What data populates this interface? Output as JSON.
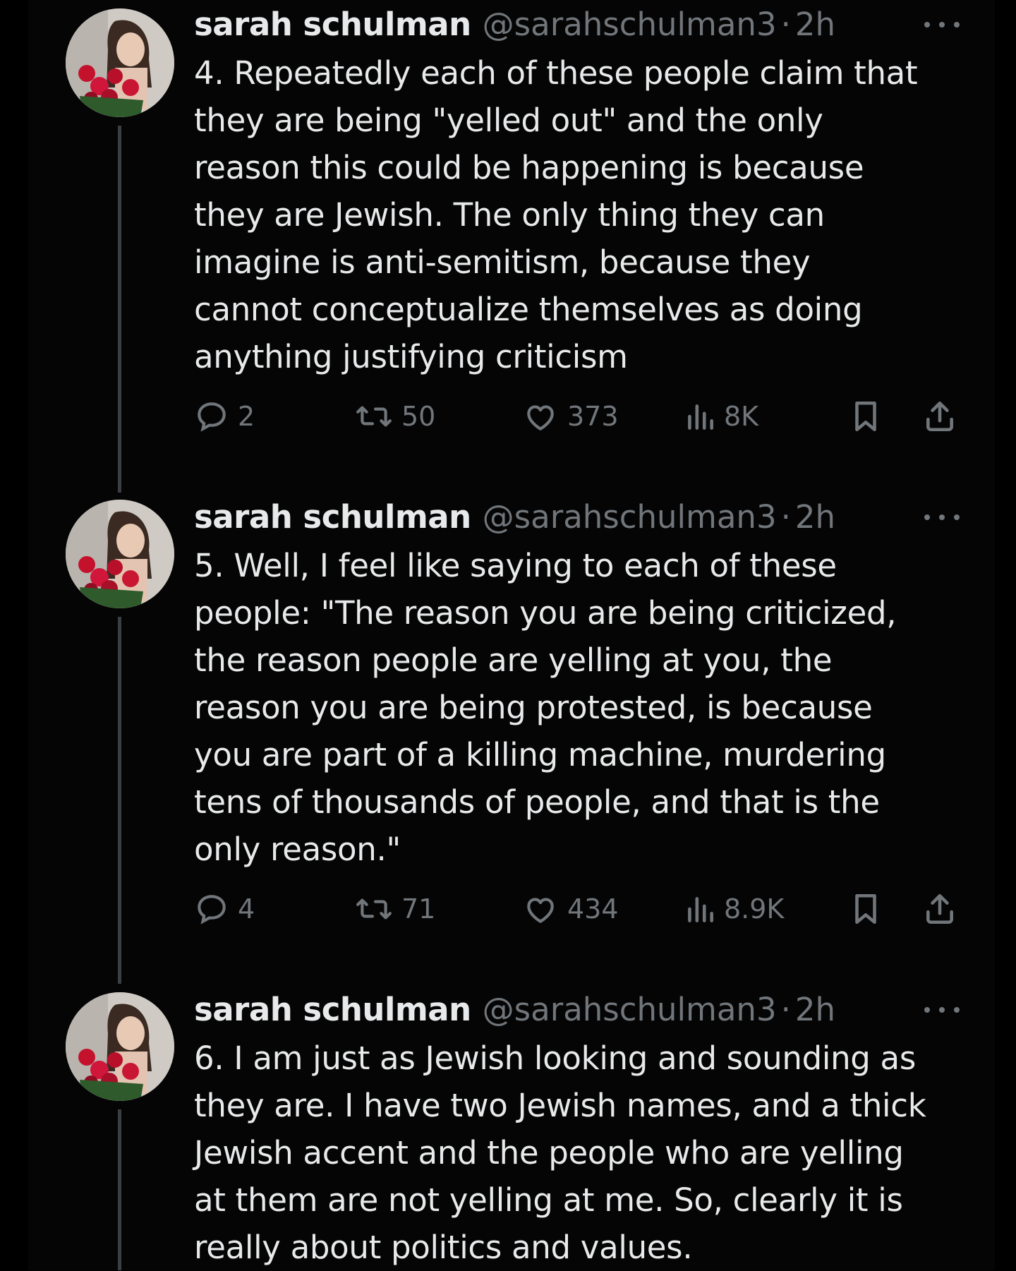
{
  "tweets": [
    {
      "name": "sarah schulman",
      "handle": "@sarahschulman3",
      "dot": "·",
      "time": "2h",
      "text": "4. Repeatedly each of these people claim that\nthey are being \"yelled out\" and the only\nreason this could be happening is because\nthey are Jewish. The only thing they can\nimagine  is anti-semitism, because they\ncannot conceptualize themselves as doing\nanything justifying criticism",
      "replies": "2",
      "reposts": "50",
      "likes": "373",
      "views": "8K"
    },
    {
      "name": "sarah schulman",
      "handle": "@sarahschulman3",
      "dot": "·",
      "time": "2h",
      "text": "5. Well, I feel like saying to each of these\npeople: \"The reason you are being criticized,\nthe reason people are yelling at you, the\nreason you are being protested, is because\nyou are part of a killing machine, murdering\ntens of thousands of people, and that is the\nonly reason.\"",
      "replies": "4",
      "reposts": "71",
      "likes": "434",
      "views": "8.9K"
    },
    {
      "name": "sarah schulman",
      "handle": "@sarahschulman3",
      "dot": "·",
      "time": "2h",
      "text": "6. I am just as Jewish looking and sounding as\nthey are. I have two Jewish names, and a thick\nJewish accent and the people who are yelling\nat them are not yelling at me. So, clearly it is\nreally about politics and values."
    }
  ],
  "icons": {
    "more": "more-icon",
    "reply": "reply-icon",
    "repost": "repost-icon",
    "like": "like-icon",
    "views": "views-icon",
    "bookmark": "bookmark-icon",
    "share": "share-icon"
  },
  "colors": {
    "background": "#000000",
    "text": "#e7e9ea",
    "secondary": "#71767b",
    "thread_line": "#3b3f43"
  }
}
